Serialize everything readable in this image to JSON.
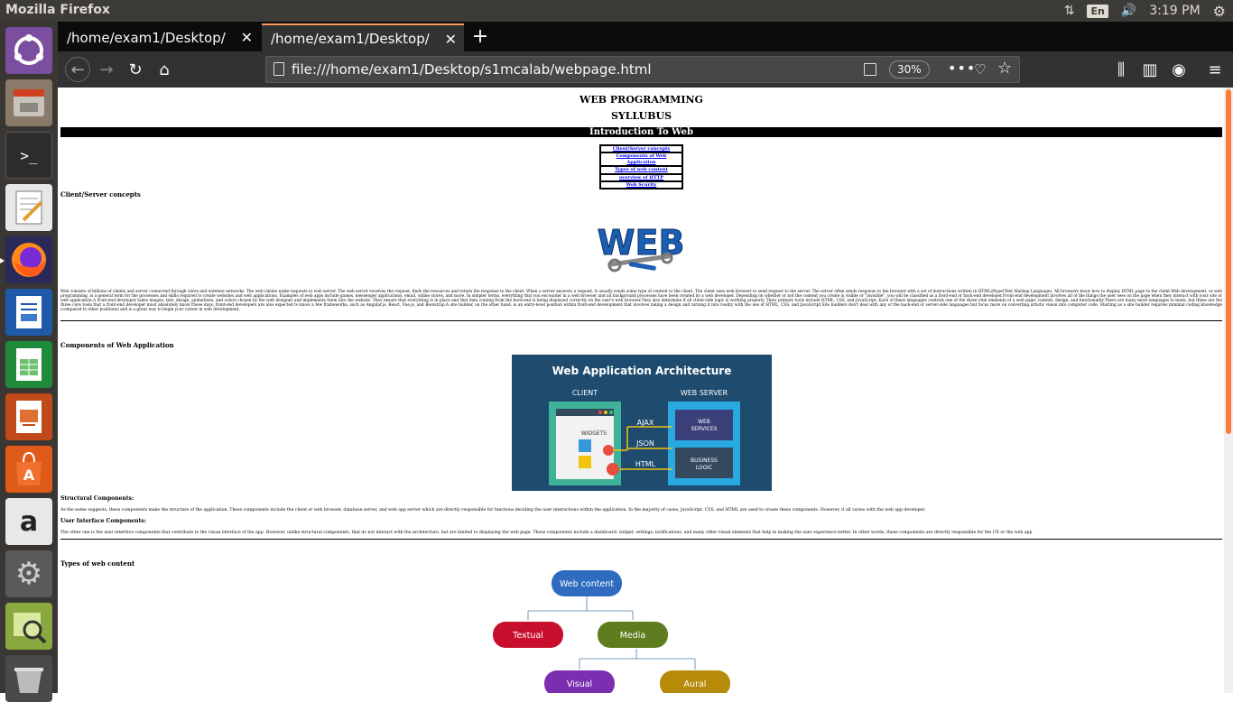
{
  "topbar": {
    "app_name": "Mozilla Firefox",
    "lang": "En",
    "time": "3:19 PM"
  },
  "launcher": {
    "items": [
      "ubuntu-dash",
      "files",
      "terminal",
      "text-editor",
      "firefox",
      "libreoffice-writer",
      "libreoffice-calc",
      "libreoffice-impress",
      "ubuntu-software",
      "amazon",
      "system-settings",
      "image-viewer",
      "trash"
    ]
  },
  "tabs": [
    {
      "label": "/home/exam1/Desktop/s1m",
      "active": false
    },
    {
      "label": "/home/exam1/Desktop/s1m",
      "active": true
    }
  ],
  "navbar": {
    "url": "file:///home/exam1/Desktop/s1mcalab/webpage.html",
    "zoom": "30%"
  },
  "page": {
    "title": "WEB PROGRAMMING",
    "subtitle": "SYLLUBUS",
    "intro_bar": "Introduction To Web",
    "toc": [
      "Client/Server concepts",
      "Components of Web Application",
      "Types of web content",
      "overview of HTTP",
      "Web Scurity"
    ],
    "sec1_heading": "Client/Server concepts",
    "web_logo_text": "WEB",
    "sec1_para": "Web consists of billions of clients and server connected through wires and wireless networks. The web clients make requests to web server. The web server receives the request, finds the resources and return the response to the client. When a server answers a request, it usually sends some type of content to the client. The client uses web browser to send request to the server. The server often sends response to the browser with a set of instructions written in HTML(HyperText Markup Language). All browsers know how to display HTML page to the client.Web development, or web programming, is a general term for the processes and skills required to create websites and web applications. Examples of web apps include games, messenger applications, email, online stores, and more. In simpler terms, everything that you encounter in a web browser and all background processes have been created by a web developer. Depending on whether or not the content you create is visible or \"invisible\", you will be classified as a front-end or back-end developer.Front-end development involves all of the things the user sees on the page when they interact with your site or web application.A front-end developer takes images, text, design, animations, and colors chosen by the web designer and implements them into the website. They ensure that everything is in place and that data coming from the back-end is being displayed correctly on the user's web browser.They also determine if all client-side logic is working properly. Their primary tools include HTML, CSS, and JavaScript. Each of these languages controls one of the three vital elements of a web page: content, design, and functionality.There are many more languages to learn, but these are the three core tools that a front-end developer must absolutely know.These days, front-end developers are also expected to know a few frameworks, such as Angular.js, React, Vue.js, and Bootstrap.A site builder, on the other hand, is an entry-level position within front-end development that involves taking a design and turning it into reality with the use of HTML, CSS, and JavaScript.Site builders don't deal with any of the back-end or server-side languages but focus more on converting artistic vision into computer code. Starting as a site builder requires minimal coding knowledge (compared to other positions) and is a great way to begin your career in web development.",
    "sec2_heading": "Components of Web Application",
    "arch": {
      "title": "Web Application Architecture",
      "client": "CLIENT",
      "server": "WEB SERVER",
      "widgets": "WIDGETS",
      "ajax": "AJAX",
      "json": "JSON",
      "html": "HTML",
      "web_services": "WEB SERVICES",
      "business_logic": "BUSINESS LOGIC"
    },
    "structural_heading": "Structural Components:",
    "structural_para": "As the name suggests, these components make the structure of the application. These components include the client or web browser, database server, and web app server which are directly responsible for functions deciding the user interactions within the application. In the majority of cases, JavaScript, CSS, and HTML are used to create these components. However, it all varies with the web app developer.",
    "ui_heading": "User Interface Components:",
    "ui_para": "The other one is the user interface components that contribute to the visual interface of the app. However, unlike structural components, that do not interact with the architecture, but are limited to displaying the web page. These components include a dashboard, widget, settings, notifications, and many other visual elements that help in making the user experience better. In other words, these components are directly responsible for the UX or the web app",
    "sec3_heading": "Types of web content",
    "diagram": {
      "root": "Web content",
      "textual": "Textual",
      "media": "Media",
      "visual": "Visual",
      "aural": "Aural"
    }
  }
}
